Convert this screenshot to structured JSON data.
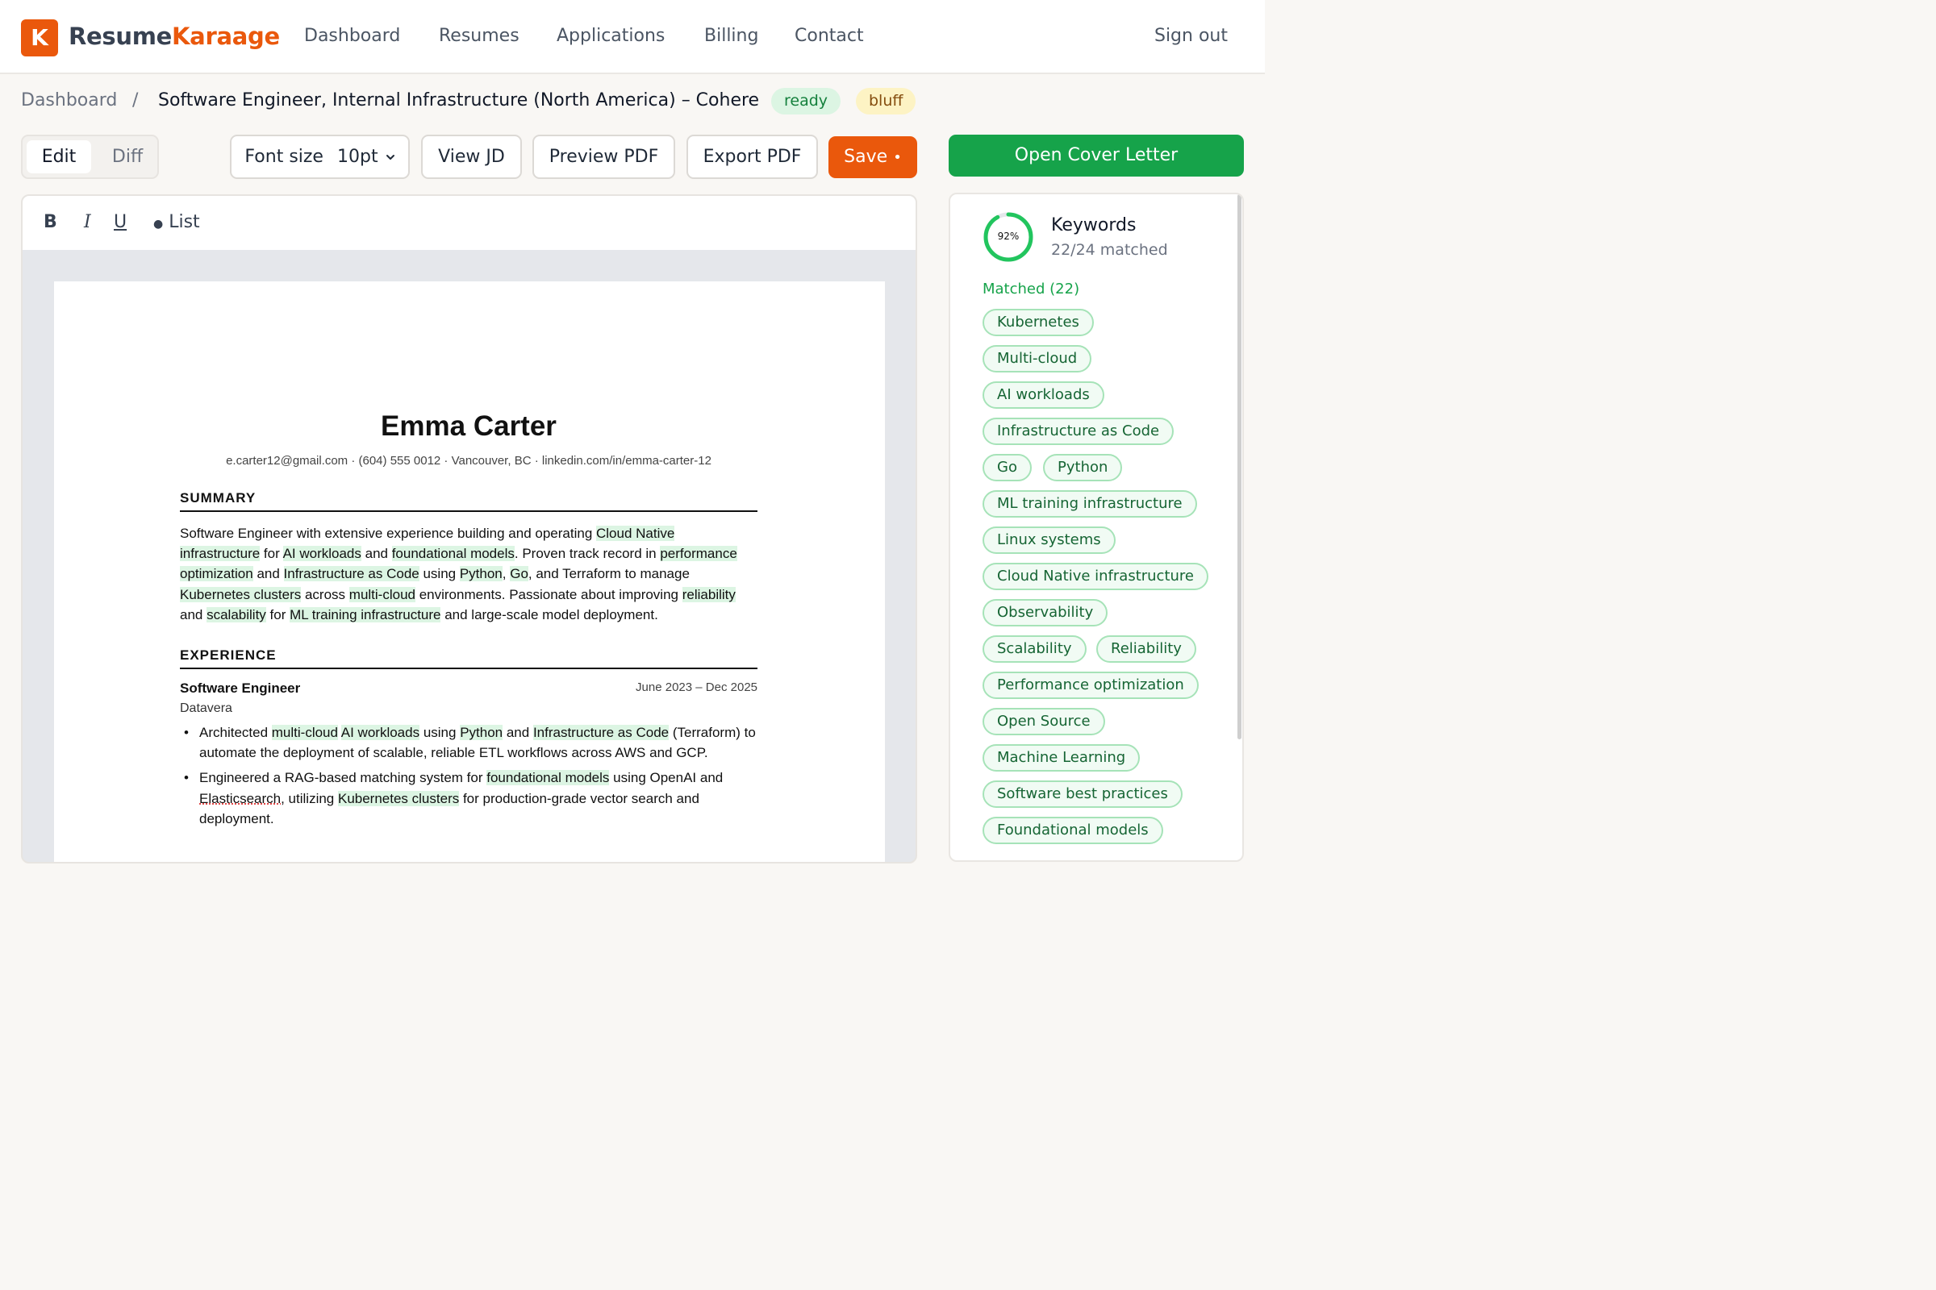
{
  "app": {
    "brand_first": "Resume",
    "brand_second": "Karaage",
    "logo_letter": "K",
    "nav": [
      "Dashboard",
      "Resumes",
      "Applications",
      "Billing",
      "Contact"
    ],
    "sign_out": "Sign out"
  },
  "breadcrumb": {
    "root": "Dashboard",
    "separator": "/",
    "title": "Software Engineer, Internal Infrastructure (North America) – Cohere",
    "badges": [
      "ready",
      "bluff"
    ]
  },
  "toolbar": {
    "tab_edit": "Edit",
    "tab_diff": "Diff",
    "font_size_label": "Font size",
    "font_size_value": "10pt",
    "view_jd": "View JD",
    "preview_pdf": "Preview PDF",
    "export_pdf": "Export PDF",
    "save": "Save",
    "save_dot": "•",
    "open_cover_letter": "Open Cover Letter"
  },
  "format_bar": {
    "bold": "B",
    "italic": "I",
    "underline": "U",
    "list": "List"
  },
  "resume": {
    "name": "Emma Carter",
    "contact": "e.carter12@gmail.com · (604) 555 0012 · Vancouver, BC · linkedin.com/in/emma-carter-12",
    "summary_heading": "SUMMARY",
    "experience_heading": "EXPERIENCE",
    "job": {
      "title": "Software Engineer",
      "dates": "June 2023 – Dec 2025",
      "company": "Datavera"
    }
  },
  "keywords": {
    "percent": 0.92,
    "percent_label": "92%",
    "title": "Keywords",
    "subtitle": "22/24 matched",
    "matched_label": "Matched (22)",
    "matched": [
      "Kubernetes",
      "Multi-cloud",
      "AI workloads",
      "Infrastructure as Code",
      "Go",
      "Python",
      "ML training infrastructure",
      "Linux systems",
      "Cloud Native infrastructure",
      "Observability",
      "Scalability",
      "Reliability",
      "Performance optimization",
      "Open Source",
      "Machine Learning",
      "Software best practices",
      "Foundational models"
    ],
    "accent": "#16a34a"
  }
}
